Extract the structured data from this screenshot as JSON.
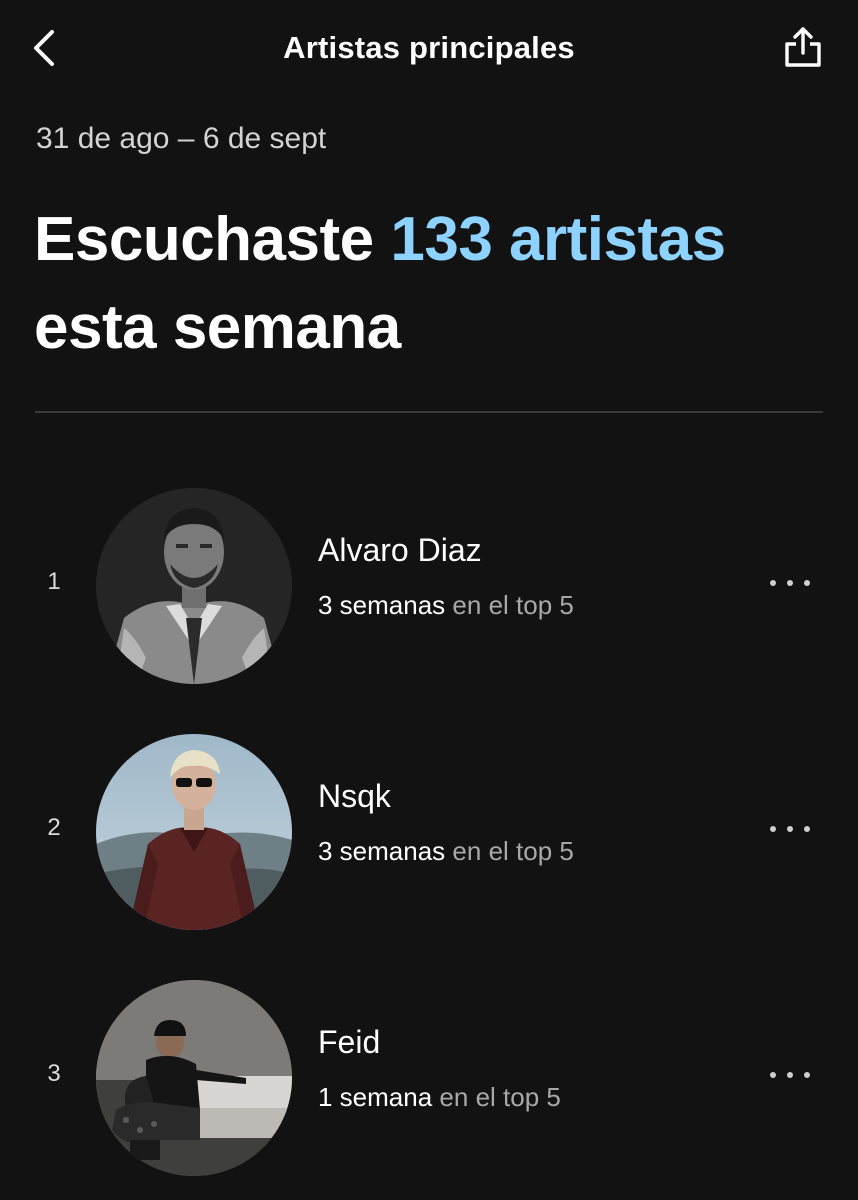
{
  "header": {
    "title": "Artistas principales",
    "back_icon": "chevron-left-icon",
    "share_icon": "share-icon"
  },
  "date_range": "31 de ago – 6 de sept",
  "headline": {
    "prefix": "Escuchaste",
    "highlight": "133 artistas",
    "suffix": "esta semana"
  },
  "colors": {
    "background": "#121212",
    "accent": "#8ed3ff",
    "muted_text": "#a8a8a8"
  },
  "artists": [
    {
      "rank": "1",
      "name": "Alvaro Diaz",
      "weeks": "3 semanas",
      "suffix": "en el top 5",
      "more_icon": "more-options-icon"
    },
    {
      "rank": "2",
      "name": "Nsqk",
      "weeks": "3 semanas",
      "suffix": "en el top 5",
      "more_icon": "more-options-icon"
    },
    {
      "rank": "3",
      "name": "Feid",
      "weeks": "1 semana",
      "suffix": "en el top 5",
      "more_icon": "more-options-icon"
    }
  ]
}
